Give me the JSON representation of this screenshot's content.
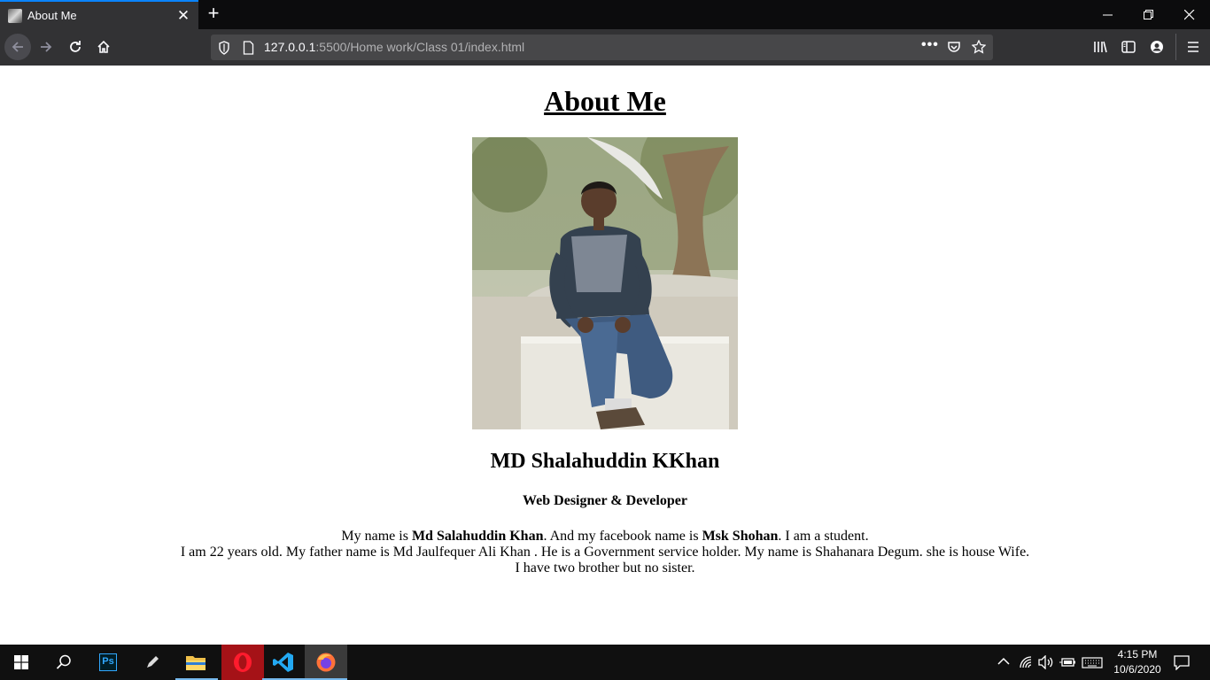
{
  "browser": {
    "tab": {
      "title": "About Me"
    },
    "url": {
      "host": "127.0.0.1",
      "path": ":5500/Home work/Class 01/index.html"
    }
  },
  "page": {
    "heading": "About Me",
    "name": "MD Shalahuddin KKhan",
    "role": "Web Designer & Developer",
    "bio": {
      "p1_a": "My name is ",
      "p1_b": "Md Salahuddin Khan",
      "p1_c": ". And my facebook name is ",
      "p1_d": "Msk Shohan",
      "p1_e": ". I am a student.",
      "line2": "I am 22 years old. My father name is Md Jaulfequer Ali Khan . He is a Government service holder. My name is Shahanara Degum. she is house Wife.",
      "line3": "I have two brother but no sister."
    }
  },
  "taskbar": {
    "time": "4:15 PM",
    "date": "10/6/2020",
    "photoshop_label": "Ps"
  },
  "colors": {
    "accent": "#0a84ff",
    "chrome_dark": "#0c0c0d",
    "toolbar": "#323234",
    "taskbar": "#101010"
  }
}
